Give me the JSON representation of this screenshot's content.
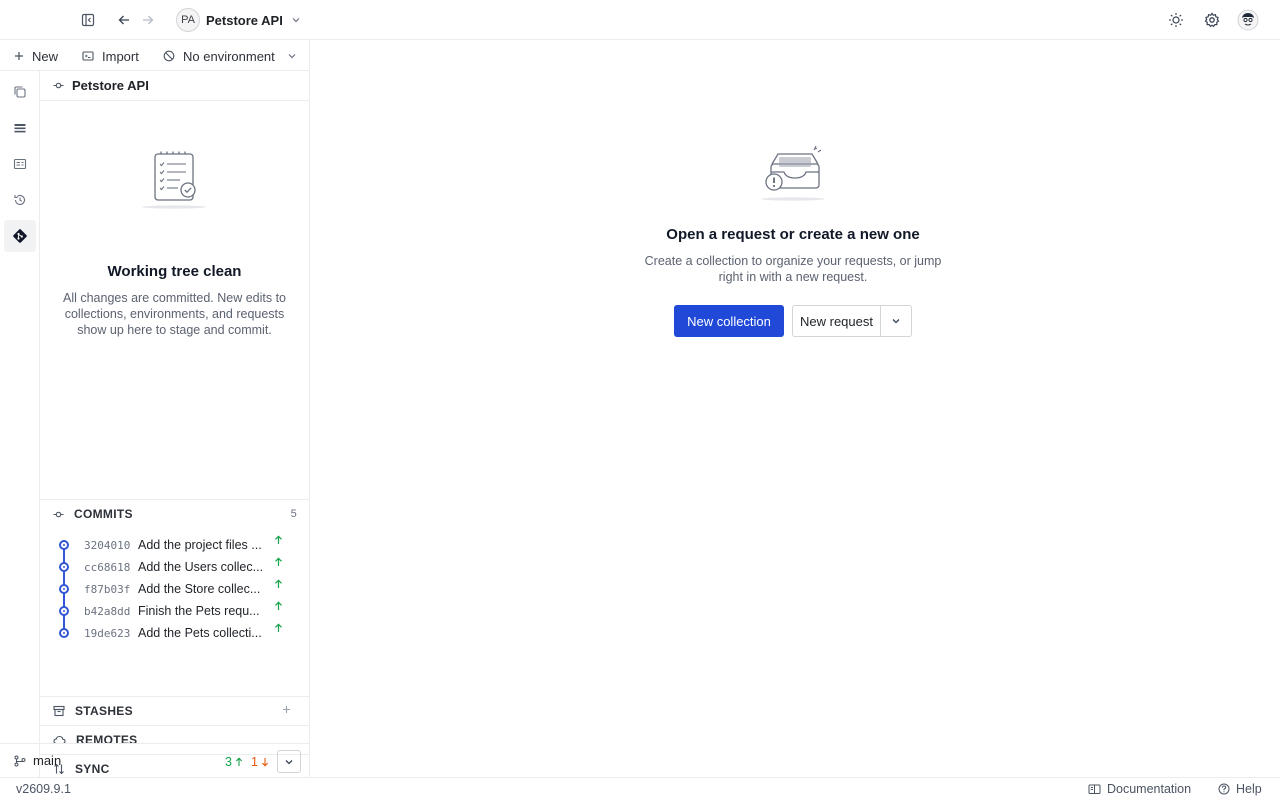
{
  "topbar": {
    "workspace_initials": "PA",
    "workspace_name": "Petstore API",
    "icons": [
      "sidebar-toggle-icon",
      "arrow-left-icon",
      "arrow-right-icon",
      "chevron-down-icon",
      "sun-icon",
      "gear-icon",
      "user-avatar-icon"
    ]
  },
  "sidebar": {
    "toolbar": {
      "new_label": "New",
      "import_label": "Import",
      "environment_label": "No environment"
    },
    "rail_icons": [
      "collections-icon",
      "list-icon",
      "environments-icon",
      "history-icon",
      "git-icon"
    ],
    "panel_title": "Petstore API",
    "clean_state": {
      "title": "Working tree clean",
      "description": "All changes are committed. New edits to collections, environments, and requests show up here to stage and commit."
    },
    "commits": {
      "title": "COMMITS",
      "count": "5",
      "items": [
        {
          "hash": "3204010",
          "message": "Add the project files ..."
        },
        {
          "hash": "cc68618",
          "message": "Add the Users collec..."
        },
        {
          "hash": "f87b03f",
          "message": "Add the Store collec..."
        },
        {
          "hash": "b42a8dd",
          "message": "Finish the Pets requ..."
        },
        {
          "hash": "19de623",
          "message": "Add the Pets collecti..."
        }
      ]
    },
    "stashes_title": "STASHES",
    "remotes_title": "REMOTES",
    "sync_title": "SYNC",
    "branch": {
      "name": "main",
      "ahead": "3",
      "behind": "1"
    }
  },
  "main": {
    "title": "Open a request or create a new one",
    "description": "Create a collection to organize your requests, or jump right in with a new request.",
    "new_collection_label": "New collection",
    "new_request_label": "New request"
  },
  "statusbar": {
    "version": "v2609.9.1",
    "documentation_label": "Documentation",
    "help_label": "Help"
  },
  "colors": {
    "accent": "#2049d8",
    "commit_line": "#3257d6",
    "ahead": "#16a34a",
    "behind": "#ea580c"
  }
}
